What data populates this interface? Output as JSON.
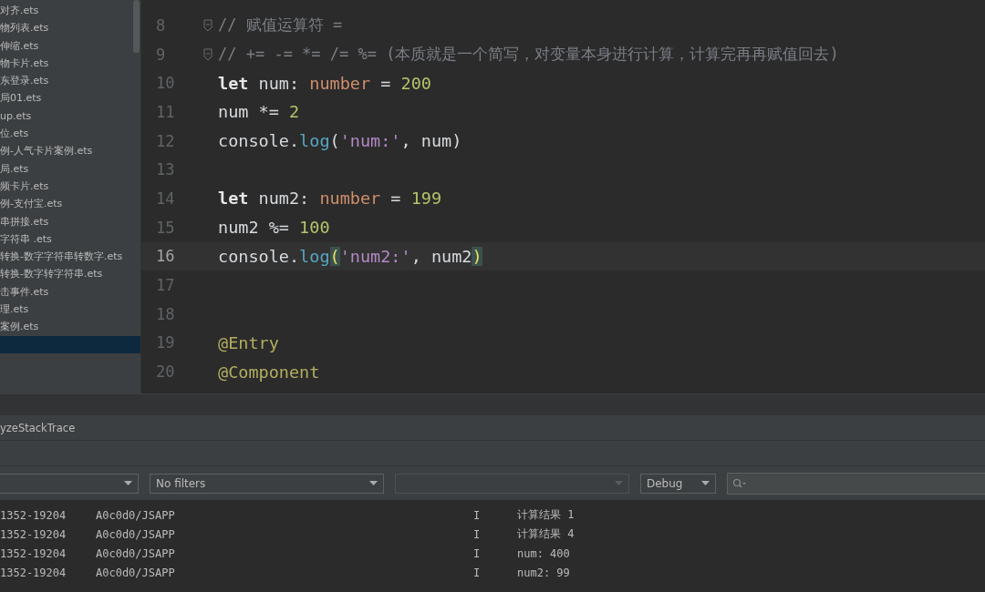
{
  "sidebar": {
    "items": [
      {
        "label": "对齐.ets",
        "selected": false
      },
      {
        "label": "物列表.ets",
        "selected": false
      },
      {
        "label": "伸缩.ets",
        "selected": false
      },
      {
        "label": "物卡片.ets",
        "selected": false
      },
      {
        "label": "东登录.ets",
        "selected": false
      },
      {
        "label": "局01.ets",
        "selected": false
      },
      {
        "label": "up.ets",
        "selected": false
      },
      {
        "label": "位.ets",
        "selected": false
      },
      {
        "label": "例-人气卡片案例.ets",
        "selected": false
      },
      {
        "label": "局.ets",
        "selected": false
      },
      {
        "label": "频卡片.ets",
        "selected": false
      },
      {
        "label": "例-支付宝.ets",
        "selected": false
      },
      {
        "label": "串拼接.ets",
        "selected": false
      },
      {
        "label": "字符串 .ets",
        "selected": false
      },
      {
        "label": "转换-数字字符串转数字.ets",
        "selected": false
      },
      {
        "label": "转换-数字转字符串.ets",
        "selected": false
      },
      {
        "label": "击事件.ets",
        "selected": false
      },
      {
        "label": "理.ets",
        "selected": false
      },
      {
        "label": "案例.ets",
        "selected": false
      },
      {
        "selected": true
      }
    ]
  },
  "editor": {
    "lines": [
      {
        "number": "8",
        "fold": true,
        "current": false,
        "tokens": [
          {
            "t": "// 赋值运算符 =",
            "kind": "comment"
          }
        ]
      },
      {
        "number": "9",
        "fold": true,
        "current": false,
        "tokens": [
          {
            "t": "// += -= *= /= %= (本质就是一个简写，对变量本身进行计算，计算完再再赋值回去)",
            "kind": "comment"
          }
        ]
      },
      {
        "number": "10",
        "fold": false,
        "current": false,
        "tokens": [
          {
            "t": "let",
            "kind": "keyword"
          },
          {
            "t": " num: ",
            "kind": "plain"
          },
          {
            "t": "number",
            "kind": "type"
          },
          {
            "t": " = ",
            "kind": "plain"
          },
          {
            "t": "200",
            "kind": "number"
          }
        ]
      },
      {
        "number": "11",
        "fold": false,
        "current": false,
        "tokens": [
          {
            "t": "num *= ",
            "kind": "plain"
          },
          {
            "t": "2",
            "kind": "number"
          }
        ]
      },
      {
        "number": "12",
        "fold": false,
        "current": false,
        "tokens": [
          {
            "t": "console.",
            "kind": "plain"
          },
          {
            "t": "log",
            "kind": "method"
          },
          {
            "t": "(",
            "kind": "plain"
          },
          {
            "t": "'num:'",
            "kind": "string"
          },
          {
            "t": ", num)",
            "kind": "plain"
          }
        ]
      },
      {
        "number": "13",
        "fold": false,
        "current": false
      },
      {
        "number": "14",
        "fold": false,
        "current": false,
        "tokens": [
          {
            "t": "let",
            "kind": "keyword"
          },
          {
            "t": " num2: ",
            "kind": "plain"
          },
          {
            "t": "number",
            "kind": "type"
          },
          {
            "t": " = ",
            "kind": "plain"
          },
          {
            "t": "199",
            "kind": "number"
          }
        ]
      },
      {
        "number": "15",
        "fold": false,
        "current": false,
        "tokens": [
          {
            "t": "num2 %= ",
            "kind": "plain"
          },
          {
            "t": "100",
            "kind": "number"
          }
        ]
      },
      {
        "number": "16",
        "fold": false,
        "current": true,
        "tokens": [
          {
            "t": "console.",
            "kind": "plain"
          },
          {
            "t": "log",
            "kind": "method"
          },
          {
            "t": "(",
            "kind": "brace"
          },
          {
            "t": "'num2:'",
            "kind": "string"
          },
          {
            "t": ", num2",
            "kind": "plain"
          },
          {
            "t": ")",
            "kind": "brace"
          }
        ]
      },
      {
        "number": "17",
        "fold": false,
        "current": false
      },
      {
        "number": "18",
        "fold": false,
        "current": false
      },
      {
        "number": "19",
        "fold": false,
        "current": false,
        "tokens": [
          {
            "t": "@Entry",
            "kind": "decorator"
          }
        ]
      },
      {
        "number": "20",
        "fold": false,
        "current": false,
        "tokens": [
          {
            "t": "@Component",
            "kind": "decorator"
          }
        ]
      }
    ]
  },
  "log_panel": {
    "tab": "yzeStackTrace",
    "filters": [
      {
        "kind": "dropdown",
        "disabled": false
      },
      {
        "kind": "dropdown",
        "value": "No filters",
        "disabled": false
      },
      {
        "kind": "dropdown",
        "disabled": true
      },
      {
        "kind": "dropdown",
        "value": "Debug",
        "disabled": false
      },
      {
        "kind": "search"
      }
    ],
    "rows": [
      {
        "pid": "1352-19204",
        "tag": "A0c0d0/JSAPP",
        "level": "I",
        "message": "计算结果 1"
      },
      {
        "pid": "1352-19204",
        "tag": "A0c0d0/JSAPP",
        "level": "I",
        "message": "计算结果 4"
      },
      {
        "pid": "1352-19204",
        "tag": "A0c0d0/JSAPP",
        "level": "I",
        "message": "num: 400"
      },
      {
        "pid": "1352-19204",
        "tag": "A0c0d0/JSAPP",
        "level": "I",
        "message": "num2: 99"
      }
    ]
  }
}
